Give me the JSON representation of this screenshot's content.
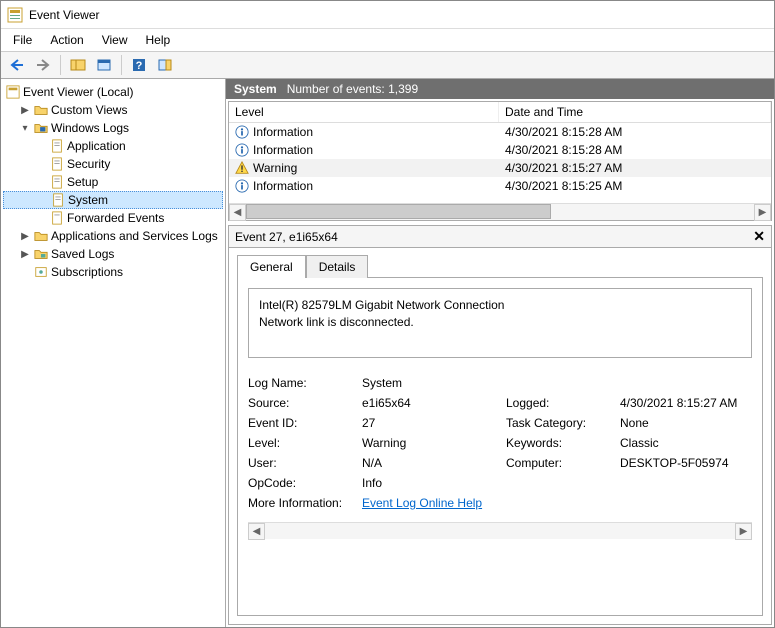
{
  "window": {
    "title": "Event Viewer"
  },
  "menu": {
    "file": "File",
    "action": "Action",
    "view": "View",
    "help": "Help"
  },
  "tree": {
    "root": "Event Viewer (Local)",
    "custom_views": "Custom Views",
    "windows_logs": "Windows Logs",
    "application": "Application",
    "security": "Security",
    "setup": "Setup",
    "system": "System",
    "forwarded": "Forwarded Events",
    "app_services": "Applications and Services Logs",
    "saved_logs": "Saved Logs",
    "subscriptions": "Subscriptions"
  },
  "pane_header": {
    "title": "System",
    "count_label": "Number of events: 1,399"
  },
  "list": {
    "col_level": "Level",
    "col_date": "Date and Time",
    "rows": [
      {
        "level": "Information",
        "icon": "info",
        "date": "4/30/2021 8:15:28 AM"
      },
      {
        "level": "Information",
        "icon": "info",
        "date": "4/30/2021 8:15:28 AM"
      },
      {
        "level": "Warning",
        "icon": "warn",
        "date": "4/30/2021 8:15:27 AM"
      },
      {
        "level": "Information",
        "icon": "info",
        "date": "4/30/2021 8:15:25 AM"
      }
    ]
  },
  "detail": {
    "title": "Event 27, e1i65x64",
    "tabs": {
      "general": "General",
      "details": "Details"
    },
    "message_l1": "Intel(R) 82579LM Gigabit Network Connection",
    "message_l2": "Network link is disconnected.",
    "labels": {
      "log_name": "Log Name:",
      "source": "Source:",
      "event_id": "Event ID:",
      "level": "Level:",
      "user": "User:",
      "opcode": "OpCode:",
      "more_info": "More Information:",
      "logged": "Logged:",
      "task_cat": "Task Category:",
      "keywords": "Keywords:",
      "computer": "Computer:"
    },
    "values": {
      "log_name": "System",
      "source": "e1i65x64",
      "event_id": "27",
      "level": "Warning",
      "user": "N/A",
      "opcode": "Info",
      "logged": "4/30/2021 8:15:27 AM",
      "task_cat": "None",
      "keywords": "Classic",
      "computer": "DESKTOP-5F05974",
      "more_info_link": "Event Log Online Help"
    }
  }
}
